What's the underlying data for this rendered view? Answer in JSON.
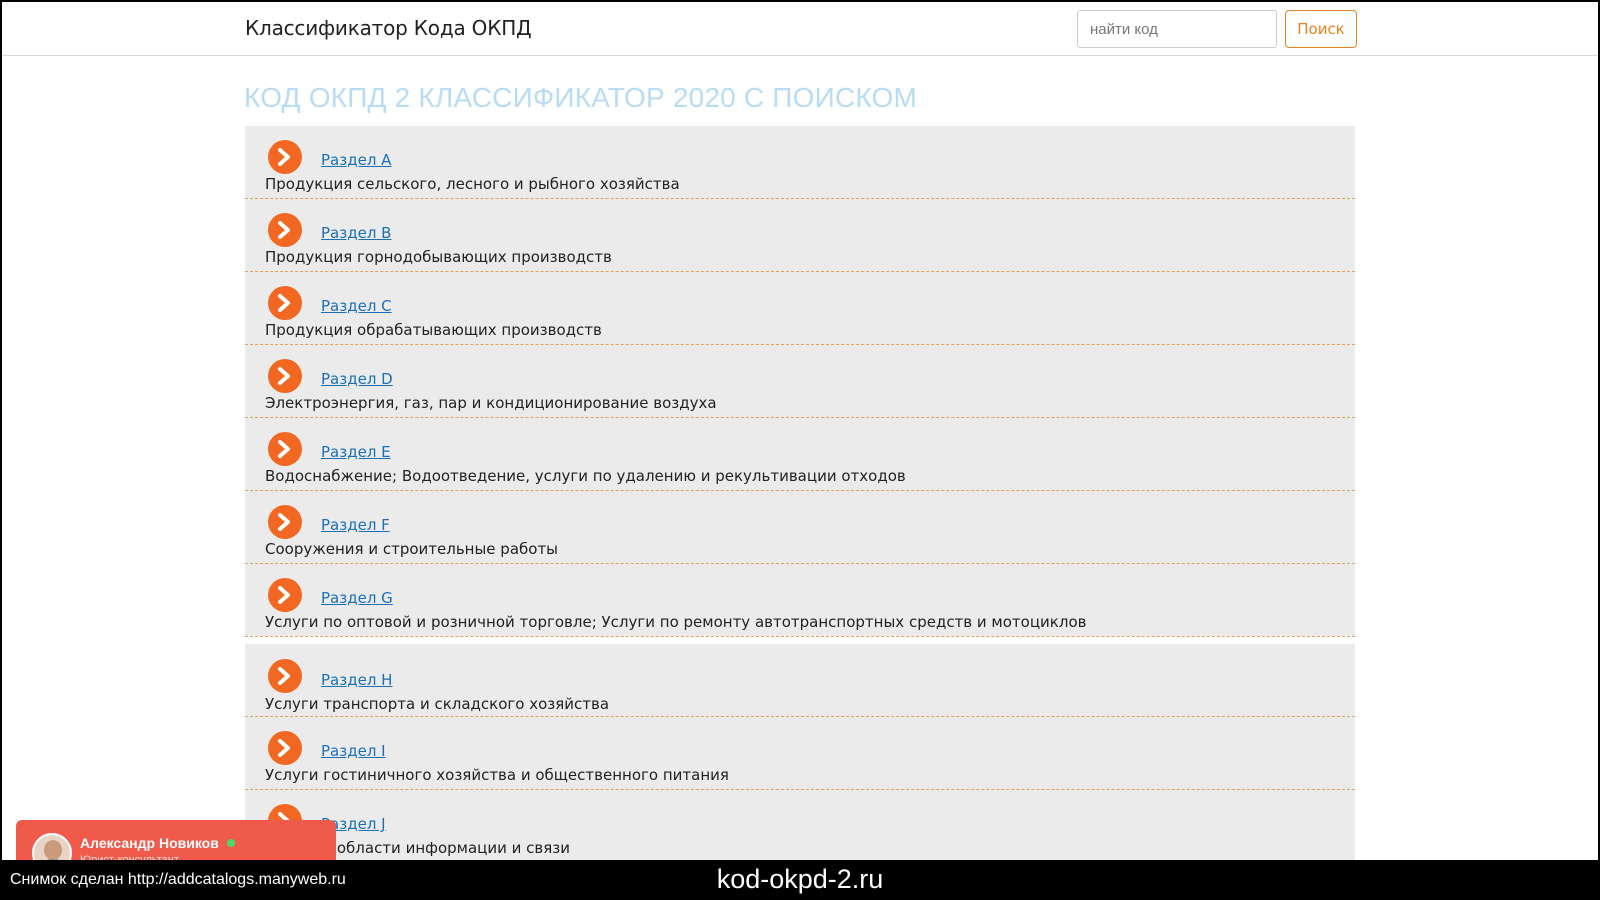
{
  "header": {
    "brand": "Классификатор Кода ОКПД",
    "search_placeholder": "найти код",
    "search_button": "Поиск"
  },
  "page_title": "КОД ОКПД 2 КЛАССИФИКАТОР 2020 С ПОИСКОМ",
  "sections": [
    {
      "label": "Раздел A",
      "desc": "Продукция сельского, лесного и рыбного хозяйства"
    },
    {
      "label": "Раздел B",
      "desc": "Продукция горнодобывающих производств"
    },
    {
      "label": "Раздел C",
      "desc": "Продукция обрабатывающих производств"
    },
    {
      "label": "Раздел D",
      "desc": "Электроэнергия, газ, пар и кондиционирование воздуха"
    },
    {
      "label": "Раздел E",
      "desc": "Водоснабжение; Водоотведение, услуги по удалению и рекультивации отходов"
    },
    {
      "label": "Раздел F",
      "desc": "Сооружения и строительные работы"
    },
    {
      "label": "Раздел G",
      "desc": "Услуги по оптовой и розничной торговле; Услуги по ремонту автотранспортных средств и мотоциклов"
    },
    {
      "label": "Раздел H",
      "desc": "Услуги транспорта и складского хозяйства"
    },
    {
      "label": "Раздел I",
      "desc": "Услуги гостиничного хозяйства и общественного питания"
    },
    {
      "label": "Раздел J",
      "desc": "Услуги в области информации и связи"
    }
  ],
  "chat": {
    "name": "Александр Новиков",
    "subtitle": "Юрист-консультант",
    "status_color": "#4cd964"
  },
  "footer": {
    "capture_note": "Снимок сделан http://addcatalogs.manyweb.ru",
    "domain": "kod-okpd-2.ru"
  },
  "colors": {
    "accent": "#f26722",
    "title": "#b8dcf3",
    "link": "#1a6fb8",
    "search_button": "#e8821f",
    "chat": "#f05a4a"
  },
  "icons": {
    "section_arrow": "chevron-right-circle-icon"
  }
}
